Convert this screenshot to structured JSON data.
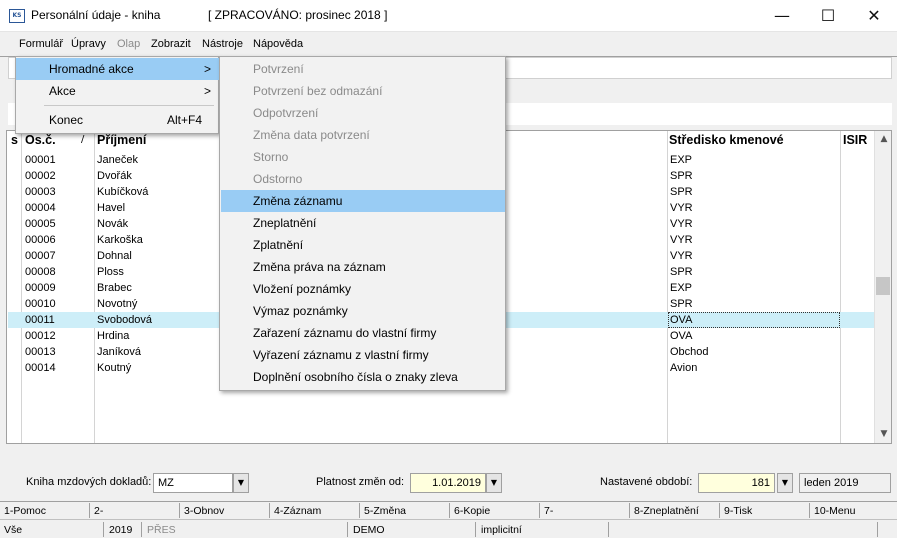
{
  "window": {
    "icon_text": "KS",
    "title": "Personální údaje - kniha",
    "status": "[ ZPRACOVÁNO: prosinec 2018 ]",
    "minimize": "—",
    "maximize": "☐",
    "close": "✕"
  },
  "menubar": [
    "Formulář",
    "Úpravy",
    "Olap",
    "Zobrazit",
    "Nástroje",
    "Nápověda"
  ],
  "menubar_disabled": [
    "Olap"
  ],
  "formular_menu": {
    "items": [
      {
        "label": "Hromadné akce",
        "shortcut": "",
        "submenu_arrow": ">",
        "highlighted": true
      },
      {
        "label": "Akce",
        "shortcut": "",
        "submenu_arrow": ">",
        "highlighted": false
      },
      {
        "label": "Konec",
        "shortcut": "Alt+F4",
        "submenu_arrow": "",
        "highlighted": false
      }
    ]
  },
  "hromadne_submenu": {
    "items": [
      {
        "label": "Potvrzení",
        "enabled": false
      },
      {
        "label": "Potvrzení bez odmazání",
        "enabled": false
      },
      {
        "label": "Odpotvrzení",
        "enabled": false
      },
      {
        "label": "Změna data potvrzení",
        "enabled": false
      },
      {
        "label": "Storno",
        "enabled": false
      },
      {
        "label": "Odstorno",
        "enabled": false
      },
      {
        "label": "Změna záznamu",
        "enabled": true,
        "highlighted": true
      },
      {
        "label": "Zneplatnění",
        "enabled": true
      },
      {
        "label": "Zplatnění",
        "enabled": true
      },
      {
        "label": "Změna práva na záznam",
        "enabled": true
      },
      {
        "label": "Vložení poznámky",
        "enabled": true
      },
      {
        "label": "Výmaz poznámky",
        "enabled": true
      },
      {
        "label": "Zařazení záznamu do vlastní firmy",
        "enabled": true
      },
      {
        "label": "Vyřazení záznamu z vlastní firmy",
        "enabled": true
      },
      {
        "label": "Doplnění osobního čísla o znaky zleva",
        "enabled": true
      }
    ]
  },
  "grid": {
    "columns": {
      "s": "s",
      "osc": "Os.č.",
      "sort_mark": "/",
      "prijmeni": "Příjmení",
      "stredisko": "Středisko kmenové",
      "isir": "ISIR"
    },
    "rows": [
      {
        "osc": "00001",
        "prijmeni": "Janeček",
        "stredisko": "EXP"
      },
      {
        "osc": "00002",
        "prijmeni": "Dvořák",
        "stredisko": "SPR"
      },
      {
        "osc": "00003",
        "prijmeni": "Kubíčková",
        "stredisko": "SPR"
      },
      {
        "osc": "00004",
        "prijmeni": "Havel",
        "stredisko": "VYR"
      },
      {
        "osc": "00005",
        "prijmeni": "Novák",
        "stredisko": "VYR"
      },
      {
        "osc": "00006",
        "prijmeni": "Karkoška",
        "stredisko": "VYR"
      },
      {
        "osc": "00007",
        "prijmeni": "Dohnal",
        "stredisko": "VYR"
      },
      {
        "osc": "00008",
        "prijmeni": "Ploss",
        "stredisko": "SPR"
      },
      {
        "osc": "00009",
        "prijmeni": "Brabec",
        "stredisko": "EXP"
      },
      {
        "osc": "00010",
        "prijmeni": "Novotný",
        "stredisko": "SPR"
      },
      {
        "osc": "00011",
        "prijmeni": "Svobodová",
        "stredisko": "OVA",
        "selected": true
      },
      {
        "osc": "00012",
        "prijmeni": "Hrdina",
        "stredisko": "OVA"
      },
      {
        "osc": "00013",
        "prijmeni": "Janíková",
        "stredisko": "Obchod"
      },
      {
        "osc": "00014",
        "prijmeni": "Koutný",
        "stredisko": "Avion"
      }
    ],
    "scroll_up": "▲",
    "scroll_down": "▼"
  },
  "bottom": {
    "kniha_label": "Kniha mzdových dokladů:",
    "kniha_value": "MZ",
    "platnost_label": "Platnost změn od:",
    "platnost_value": "1.01.2019",
    "obdobi_label": "Nastavené období:",
    "obdobi_value": "181",
    "obdobi_text": "leden 2019",
    "dropdown_glyph": "▼"
  },
  "fkeys": [
    "1-Pomoc",
    "2-",
    "3-Obnov",
    "4-Záznam",
    "5-Změna",
    "6-Kopie",
    "7-",
    "8-Zneplatnění",
    "9-Tisk",
    "10-Menu"
  ],
  "statusbar": {
    "scope": "Vše",
    "year": "2019",
    "mode": "PŘES",
    "db": "DEMO",
    "extra": "implicitní"
  },
  "colors": {
    "menu_highlight": "#99ccf4",
    "selected_row": "#cdeef8",
    "yellow_field": "#ffffdd"
  }
}
